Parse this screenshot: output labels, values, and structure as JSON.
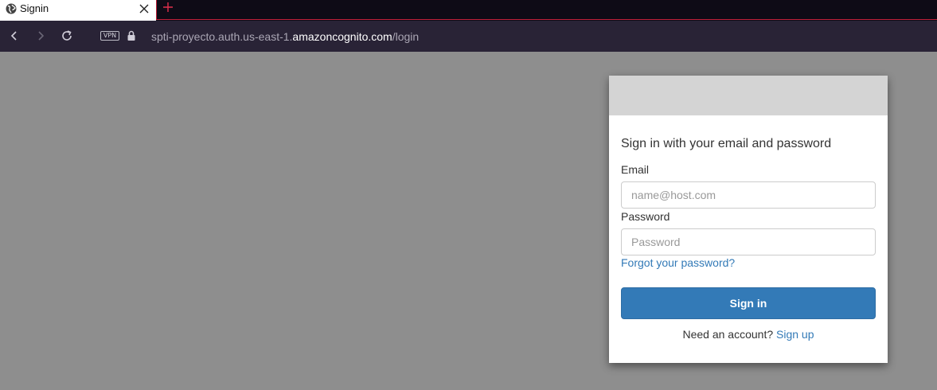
{
  "browser": {
    "tab": {
      "title": "Signin",
      "favicon": "globe-icon",
      "close_icon": "close-icon"
    },
    "new_tab_icon": "plus-icon",
    "toolbar": {
      "back_icon": "chevron-left-icon",
      "forward_icon": "chevron-right-icon",
      "reload_icon": "reload-icon",
      "vpn_label": "VPN",
      "lock_icon": "lock-icon",
      "url_prefix": "spti-proyecto.auth.us-east-1.",
      "url_host": "amazoncognito.com",
      "url_path": "/login"
    },
    "colors": {
      "tab_accent": "#c0203a",
      "toolbar_bg": "#292336",
      "page_bg": "#8e8e8e"
    }
  },
  "login": {
    "heading": "Sign in with your email and password",
    "email_label": "Email",
    "email_placeholder": "name@host.com",
    "email_value": "",
    "password_label": "Password",
    "password_placeholder": "Password",
    "password_value": "",
    "forgot_password": "Forgot your password?",
    "submit_label": "Sign in",
    "signup_prompt": "Need an account?",
    "signup_link": "Sign up",
    "colors": {
      "primary": "#337ab7",
      "header_bg": "#d4d4d4"
    }
  }
}
